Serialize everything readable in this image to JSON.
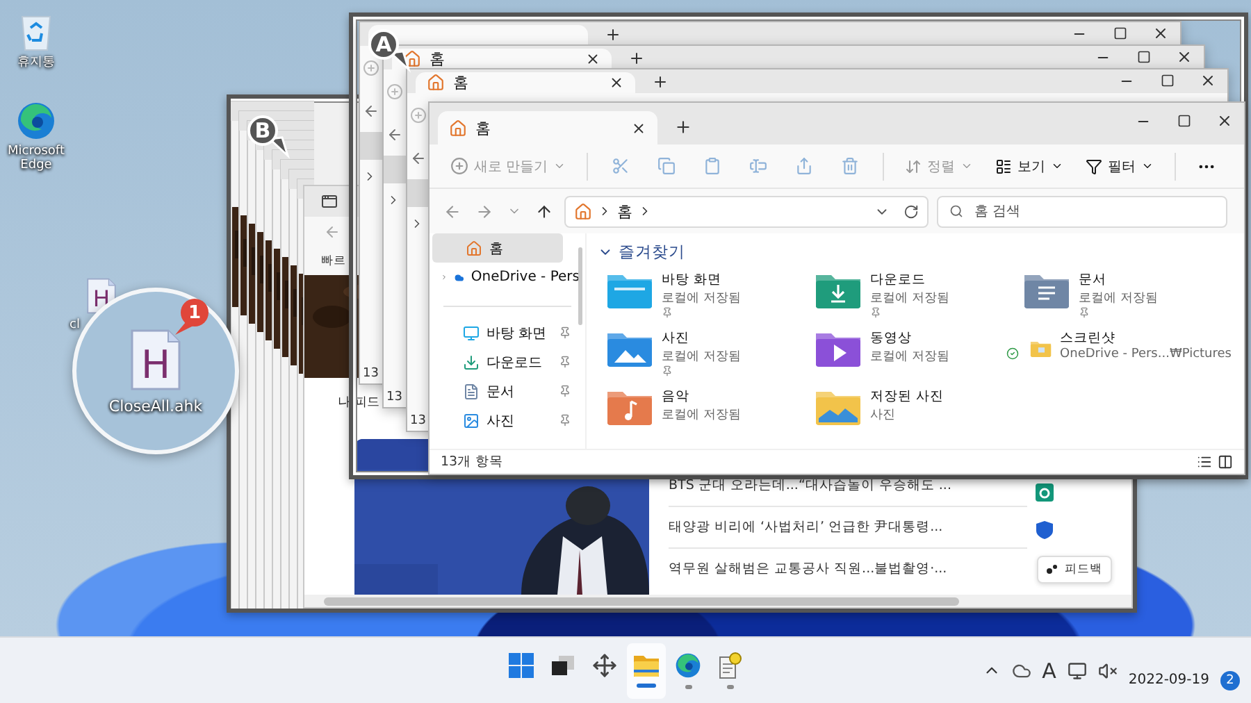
{
  "desktop_icons": [
    {
      "label": "휴지통",
      "kind": "recycle"
    },
    {
      "label": "Microsoft Edge",
      "kind": "edge"
    },
    {
      "label": "cl",
      "kind": "script",
      "glyph": "H"
    }
  ],
  "magnifier": {
    "file_label": "CloseAll.ahk",
    "glyph": "H",
    "badge": "1"
  },
  "callouts": [
    {
      "letter": "A"
    },
    {
      "letter": "B"
    }
  ],
  "browser": {
    "bookmark": "빠르",
    "side_text": "나",
    "feed_label": "피드",
    "headlines": [
      "BTS 군대 오라는데...“대사습놀이 우승해도 ...",
      "태양광 비리에 ‘사법처리’ 언급한 尹대통령...",
      "역무원 살해범은 교통공사 직원...불법촬영·..."
    ],
    "feedback_button": "피드백"
  },
  "explorer_back": [
    {
      "status": "13"
    },
    {
      "tab": "홈",
      "status": "13"
    },
    {
      "tab": "홈",
      "status": "13"
    }
  ],
  "explorer": {
    "tab": "홈",
    "toolbar": {
      "new": {
        "label": "새로 만들기",
        "disabled": true
      },
      "actions": [
        {
          "disabled": true
        },
        {
          "disabled": true
        },
        {
          "disabled": true
        },
        {
          "disabled": true
        },
        {
          "disabled": true
        },
        {
          "disabled": true
        }
      ],
      "sort": {
        "label": "정렬",
        "disabled": true
      },
      "view": {
        "label": "보기",
        "disabled": false
      },
      "filter": {
        "label": "필터",
        "disabled": false
      }
    },
    "address": "홈",
    "search": {
      "placeholder": "홈 검색"
    },
    "nav": {
      "roots": [
        {
          "label": "홈",
          "selected": true,
          "expandable": false
        },
        {
          "label": "OneDrive - Pers",
          "selected": false,
          "expandable": true
        }
      ],
      "quick": [
        {
          "label": "바탕 화면",
          "pinned": true
        },
        {
          "label": "다운로드",
          "pinned": true
        },
        {
          "label": "문서",
          "pinned": true
        },
        {
          "label": "사진",
          "pinned": true
        }
      ]
    },
    "section": {
      "title": "즐겨찾기",
      "expanded": true
    },
    "items": [
      {
        "name": "바탕 화면",
        "location": "로컬에 저장됨",
        "pinned": true,
        "synced": false
      },
      {
        "name": "다운로드",
        "location": "로컬에 저장됨",
        "pinned": true,
        "synced": false
      },
      {
        "name": "문서",
        "location": "로컬에 저장됨",
        "pinned": true,
        "synced": false
      },
      {
        "name": "사진",
        "location": "로컬에 저장됨",
        "pinned": true,
        "synced": false
      },
      {
        "name": "동영상",
        "location": "로컬에 저장됨",
        "pinned": false,
        "synced": false
      },
      {
        "name": "스크린샷",
        "location": "OneDrive - Pers...₩Pictures",
        "pinned": false,
        "synced": true
      },
      {
        "name": "음악",
        "location": "로컬에 저장됨",
        "pinned": false,
        "synced": false
      },
      {
        "name": "저장된 사진",
        "location": "사진",
        "pinned": false,
        "synced": false
      }
    ],
    "status": "13개 항목"
  },
  "taskbar": {
    "apps": [
      {
        "active": false,
        "running": false
      },
      {
        "active": false,
        "running": false
      },
      {
        "active": false,
        "running": false
      },
      {
        "active": true,
        "running": true
      },
      {
        "active": false,
        "running": true
      },
      {
        "active": false,
        "running": true
      }
    ],
    "ime": "A",
    "date": "2022-09-19",
    "notifications": "2"
  }
}
